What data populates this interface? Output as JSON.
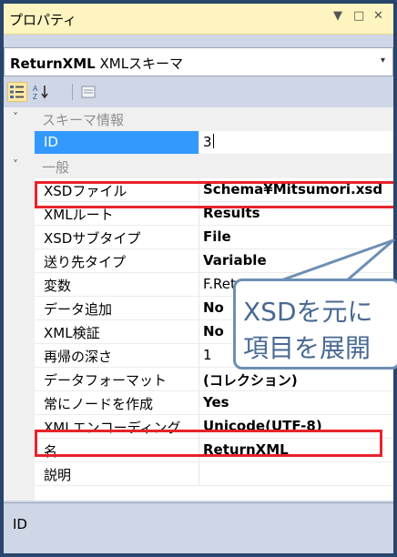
{
  "window": {
    "title": "プロパティ",
    "pin_glyph": "▼",
    "maximize_glyph": "□",
    "close_glyph": "✕"
  },
  "selector": {
    "object_name": "ReturnXML",
    "object_type": "XMLスキーマ",
    "caret_glyph": "▾"
  },
  "toolbar": {
    "categorized_icon": "categorized-icon",
    "alphabetical_icon": "alphabetical-icon",
    "alphabetical_glyph": "↓",
    "property_pages_icon": "property-pages-icon"
  },
  "grid": {
    "categories": [
      {
        "label": "スキーマ情報",
        "chevron": "˅"
      },
      {
        "label": "一般",
        "chevron": "˅"
      }
    ],
    "rows": [
      {
        "name": "ID",
        "value": "3",
        "bold": false
      },
      {
        "name": "XSDファイル",
        "value": "Schema¥Mitsumori.xsd",
        "bold": true
      },
      {
        "name": "XMLルート",
        "value": "Results",
        "bold": true
      },
      {
        "name": "XSDサブタイプ",
        "value": "File",
        "bold": true
      },
      {
        "name": "送り先タイプ",
        "value": "Variable",
        "bold": true
      },
      {
        "name": "変数",
        "value": "F.Ret",
        "bold": false
      },
      {
        "name": "データ追加",
        "value": "No",
        "bold": true
      },
      {
        "name": "XML検証",
        "value": "No",
        "bold": true
      },
      {
        "name": "再帰の深さ",
        "value": "1",
        "bold": false
      },
      {
        "name": "データフォーマット",
        "value": "(コレクション)",
        "bold": true
      },
      {
        "name": "常にノードを作成",
        "value": "Yes",
        "bold": true
      },
      {
        "name": "XMLエンコーディング",
        "value": "Unicode(UTF-8)",
        "bold": true
      },
      {
        "name": "名",
        "value": "ReturnXML",
        "bold": true
      },
      {
        "name": "説明",
        "value": "",
        "bold": false
      }
    ]
  },
  "description": {
    "title": "ID"
  },
  "callout": {
    "line1": "XSDを元に",
    "line2": "項目を展開"
  },
  "colors": {
    "frame": "#29456b",
    "titlebar": "#fdf4bf",
    "selection": "#3399ff",
    "highlight_box": "#e8232a",
    "callout_border": "#6d8fb4",
    "callout_text": "#4a6a92"
  }
}
